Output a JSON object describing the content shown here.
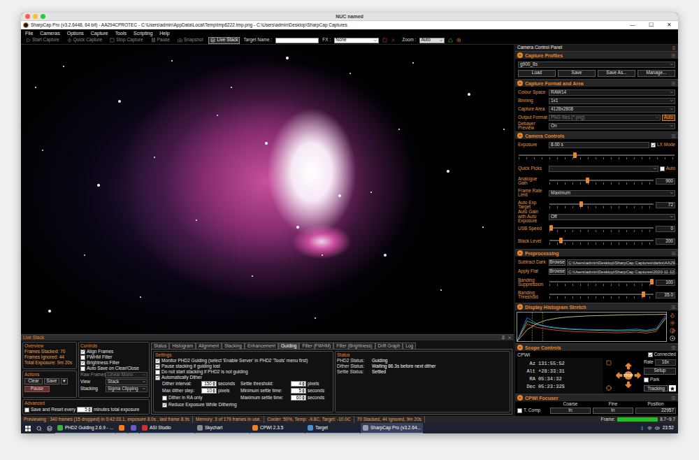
{
  "host_window": {
    "title": "NUC named"
  },
  "window": {
    "title": "SharpCap Pro (v3.2.6448, 64 bit) - AA294CPROTEC - C:\\Users\\admin\\AppData\\Local\\Temp\\tmp6222.tmp.png - C:\\Users\\admin\\Desktop\\SharpCap Captures",
    "controls": [
      "—",
      "☐",
      "✕"
    ]
  },
  "menu": [
    "File",
    "Cameras",
    "Options",
    "Capture",
    "Tools",
    "Scripting",
    "Help"
  ],
  "toolbar": {
    "buttons": [
      {
        "label": "Start Capture",
        "disabled": true,
        "selected": false
      },
      {
        "label": "Quick Capture",
        "disabled": true,
        "selected": false
      },
      {
        "label": "Stop Capture",
        "disabled": true,
        "selected": false
      },
      {
        "label": "Pause",
        "disabled": true,
        "selected": false
      },
      {
        "label": "Snapshot",
        "disabled": true,
        "selected": false
      },
      {
        "label": "Live Stack",
        "disabled": false,
        "selected": true
      }
    ],
    "target_label": "Target Name :",
    "target_value": "",
    "fx_label": "FX :",
    "fx_value": "None",
    "zoom_label": "Zoom :",
    "zoom_value": "Auto"
  },
  "live_stack": {
    "title": "Live Stack",
    "overview": {
      "title": "Overview",
      "rows": [
        {
          "label": "Frames Stacked:",
          "value": "70"
        },
        {
          "label": "Frames Ignored:",
          "value": "44"
        },
        {
          "label": "Total Exposure:",
          "value": "9m 20s"
        }
      ]
    },
    "actions": {
      "title": "Actions",
      "buttons": [
        "Clear",
        "Save",
        "▾"
      ],
      "pause": "Pause"
    },
    "advanced": {
      "title": "Advanced",
      "label": "Save and Reset every",
      "checked": false,
      "value": "5",
      "suffix": "minutes total exposure"
    },
    "controls": {
      "title": "Controls",
      "checkboxes": [
        {
          "label": "Align Frames",
          "checked": true
        },
        {
          "label": "FWHM Filter",
          "checked": false
        },
        {
          "label": "Brightness Filter",
          "checked": true
        },
        {
          "label": "Auto Save on Clear/Close",
          "checked": false
        }
      ],
      "selects": [
        {
          "label": "Raw Frames",
          "value": "Linear Mono",
          "disabled": true
        },
        {
          "label": "View",
          "value": "Stack",
          "disabled": false
        },
        {
          "label": "Stacking",
          "value": "Sigma Clipping",
          "disabled": false
        }
      ]
    },
    "tabs": [
      {
        "label": "Status",
        "selected": false
      },
      {
        "label": "Histogram",
        "selected": false
      },
      {
        "label": "Alignment",
        "selected": false
      },
      {
        "label": "Stacking",
        "selected": false
      },
      {
        "label": "Enhancement",
        "selected": false
      },
      {
        "label": "Guiding",
        "selected": true
      },
      {
        "label": "Filter (FWHM)",
        "selected": false
      },
      {
        "label": "Filter (Brightness)",
        "selected": false
      },
      {
        "label": "Drift Graph",
        "selected": false
      },
      {
        "label": "Log",
        "selected": false
      }
    ],
    "settings": {
      "title": "Settings",
      "checkboxes": [
        {
          "label": "Monitor PHD2 Guiding (select 'Enable Server' in PHD2 'Tools' menu first)",
          "checked": true
        },
        {
          "label": "Pause stacking if guiding lost",
          "checked": true
        },
        {
          "label": "Do not start stacking if PHD2 is not guiding",
          "checked": false
        },
        {
          "label": "Automatically Dither",
          "checked": true
        }
      ],
      "left": [
        {
          "kind": "number",
          "label": "Dither interval:",
          "value": "150",
          "unit": "seconds"
        },
        {
          "kind": "number",
          "label": "Max dither step:",
          "value": "10",
          "unit": "pixels"
        },
        {
          "kind": "checkbox",
          "label": "Dither in RA only",
          "checked": false
        },
        {
          "kind": "checkbox",
          "label": "Reduce Exposure While Dithering",
          "checked": true
        }
      ],
      "right": [
        {
          "kind": "number",
          "label": "Settle threshold:",
          "value": "4",
          "unit": "pixels"
        },
        {
          "kind": "number",
          "label": "Minimum settle time:",
          "value": "5",
          "unit": "seconds"
        },
        {
          "kind": "number",
          "label": "Maximum settle time:",
          "value": "60",
          "unit": "seconds"
        }
      ]
    },
    "status": {
      "title": "Status",
      "rows": [
        {
          "label": "PHD2 Status:",
          "value": "Guiding"
        },
        {
          "label": "Dither Status:",
          "value": "Waiting 86.3s before next dither"
        },
        {
          "label": "Settle Status:",
          "value": "Settled"
        }
      ]
    }
  },
  "camera_panel": {
    "title": "Camera Control Panel",
    "profiles": {
      "title": "Capture Profiles",
      "expanded": true,
      "value": "g900_8s",
      "buttons": [
        "Load",
        "Save",
        "Save As...",
        "Manage..."
      ]
    },
    "format": {
      "title": "Capture Format and Area",
      "expanded": true,
      "rows": [
        {
          "label": "Colour Space",
          "value": "RAW14",
          "disabled": false
        },
        {
          "label": "Binning",
          "value": "1x1",
          "disabled": false
        },
        {
          "label": "Capture Area",
          "value": "4128x2808",
          "disabled": false
        },
        {
          "label": "Output Format",
          "value": "PNG files (*.png)",
          "disabled": true,
          "button": "Auto"
        },
        {
          "label": "Debayer Preview",
          "value": "On",
          "disabled": false
        }
      ]
    },
    "controls": {
      "title": "Camera Controls",
      "expanded": true,
      "rows": [
        {
          "kind": "exposure",
          "label": "Exposure",
          "value": "8.00 s",
          "check_label": "LX Mode",
          "checked": true
        },
        {
          "kind": "track",
          "level": 0.36
        },
        {
          "kind": "quickpicks",
          "label": "Quick Picks",
          "value": "",
          "check_label": "Auto",
          "checked": false
        },
        {
          "kind": "slider",
          "label": "Analogue Gain",
          "level": 0.36,
          "value": "900"
        },
        {
          "kind": "select",
          "label": "Frame Rate Limit",
          "value": "Maximum"
        },
        {
          "kind": "slider",
          "label": "Auto Exp Target",
          "level": 0.3,
          "value": "72"
        },
        {
          "kind": "select",
          "label": "Auto Gain with Auto Exposure",
          "value": "Off"
        },
        {
          "kind": "slider",
          "label": "USB Speed",
          "level": 0,
          "value": "0"
        },
        {
          "kind": "slider",
          "label": "Black Level",
          "level": 0.1,
          "value": "200"
        }
      ]
    },
    "preprocessing": {
      "title": "Preprocessing",
      "expanded": true,
      "rows": [
        {
          "kind": "path",
          "label": "Subtract Dark",
          "button": "Browse",
          "value": "C:\\Users\\admin\\Desktop\\SharpCap Captures\\darks\\AA29..."
        },
        {
          "kind": "path",
          "label": "Apply Flat",
          "button": "Browse",
          "value": "C:\\Users\\admin\\Desktop\\SharpCap Captures\\2020-11-12..."
        },
        {
          "kind": "slider",
          "label": "Banding Suppression",
          "level": 1,
          "value": "100"
        },
        {
          "kind": "slider",
          "label": "Banding Threshold",
          "level": 0.92,
          "value": "35.0"
        }
      ]
    },
    "histogram": {
      "title": "Display Histogram Stretch",
      "expanded": true,
      "black_point": 0.1,
      "mid_point": 0.17,
      "series": [
        {
          "name": "red",
          "color": "#e03a3a",
          "values": [
            2,
            60,
            48,
            42,
            38,
            35,
            33,
            32,
            31,
            30,
            29,
            30,
            32,
            28,
            34,
            85
          ]
        },
        {
          "name": "green",
          "color": "#3cc83c",
          "values": [
            2,
            70,
            58,
            50,
            45,
            42,
            40,
            39,
            38,
            37,
            36,
            36,
            38,
            34,
            40,
            80
          ]
        },
        {
          "name": "blue",
          "color": "#3a6af0",
          "values": [
            2,
            82,
            60,
            52,
            47,
            44,
            42,
            41,
            40,
            40,
            39,
            40,
            42,
            38,
            44,
            92
          ]
        }
      ],
      "stretch": {
        "color": "#c8b870",
        "values": [
          0,
          40,
          62,
          74,
          80,
          84,
          86,
          88,
          89,
          90,
          91,
          92,
          92,
          93,
          93,
          94
        ]
      }
    },
    "scope": {
      "title": "Scope Controls",
      "expanded": true,
      "device": "CPWI",
      "connected_label": "Connected",
      "connected": true,
      "coords": [
        {
          "label": "Az",
          "value": "131:55:52"
        },
        {
          "label": "Alt",
          "value": "+28:33:31"
        },
        {
          "label": "RA",
          "value": "05:34:32"
        },
        {
          "label": "Dec",
          "value": "05:23:32S"
        }
      ],
      "rate_label": "Rate",
      "rate": "16x",
      "setup": "Setup",
      "park_label": "Park",
      "parked": false,
      "tracking": "Tracking",
      "stop": "STOP"
    },
    "focuser": {
      "title": "CPWI Focuser",
      "expanded": true,
      "tcomp_label": "T. Comp",
      "tcomp": false,
      "columns": [
        "Coarse",
        "Fine",
        "Position"
      ],
      "buttons": [
        "In",
        "In"
      ],
      "position": "22957"
    }
  },
  "status_bar": {
    "segments": [
      "Previewing : 340 frames (15 dropped) in 0:42:03.1, exposure 8.0s , last frame 8.9s",
      "Memory: 3 of 179 frames in use.",
      "Cooler: 50%, Temp: -9.8C, Target: -10.0C",
      "70 Stacked, 44 Ignored, 9m 20s"
    ],
    "frame_label": "Frame:",
    "frame_level": 1,
    "frame_value": "8.7~9.7"
  },
  "taskbar": {
    "items": [
      {
        "label": "PHD2 Guiding 2.6.9 - ...",
        "color": "#3cb043",
        "active": false
      },
      {
        "label": "",
        "color": "#ff7a1a",
        "active": false
      },
      {
        "label": "",
        "color": "#6a5acd",
        "active": false
      },
      {
        "label": "ASI Studio",
        "color": "#d03030",
        "active": false
      },
      {
        "label": "Skychart",
        "color": "#8a8a8a",
        "active": false
      },
      {
        "label": "CPWI 2.3.5",
        "color": "#f08020",
        "active": false
      },
      {
        "label": "Target",
        "color": "#4a90d0",
        "active": false
      },
      {
        "label": "SharpCap Pro (v3.2.64...",
        "color": "#9a9ab0",
        "active": true
      }
    ],
    "time": "23:52"
  }
}
